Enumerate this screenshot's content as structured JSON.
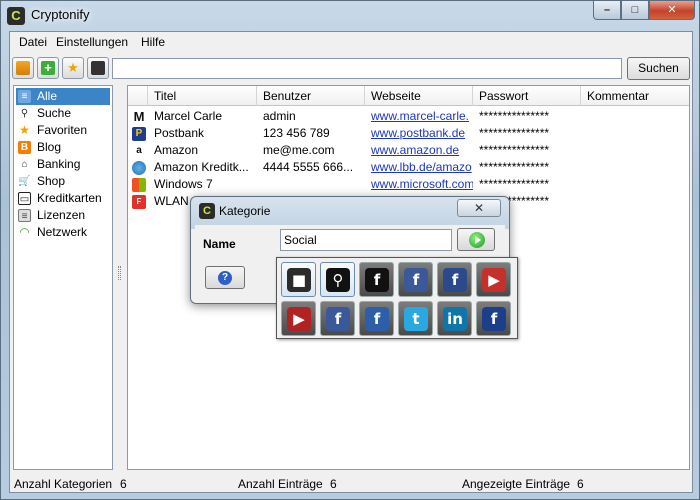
{
  "window": {
    "title": "Cryptonify",
    "minimize": "–",
    "maximize": "□",
    "close": "✕"
  },
  "menu": {
    "items": [
      "Datei",
      "Einstellungen",
      "Hilfe"
    ]
  },
  "toolbar": {
    "search_value": "",
    "search_button": "Suchen",
    "buttons": [
      "open-safe-icon",
      "add-entry-icon",
      "favorite-entry-icon",
      "save-icon"
    ]
  },
  "sidebar": {
    "items": [
      {
        "label": "Alle",
        "icon": "all-icon",
        "selected": true
      },
      {
        "label": "Suche",
        "icon": "magnifier-icon"
      },
      {
        "label": "Favoriten",
        "icon": "star-icon"
      },
      {
        "label": "Blog",
        "icon": "blogger-icon"
      },
      {
        "label": "Banking",
        "icon": "bank-icon"
      },
      {
        "label": "Shop",
        "icon": "cart-icon"
      },
      {
        "label": "Kreditkarten",
        "icon": "credit-card-icon"
      },
      {
        "label": "Lizenzen",
        "icon": "license-icon"
      },
      {
        "label": "Netzwerk",
        "icon": "wifi-icon"
      }
    ]
  },
  "table": {
    "columns": [
      "Titel",
      "Benutzer",
      "Webseite",
      "Passwort",
      "Kommentar"
    ],
    "rows": [
      {
        "icon": "marcel-m-icon",
        "titel": "Marcel Carle",
        "benutzer": "admin",
        "webseite": "www.marcel-carle.",
        "passwort": "***************",
        "kommentar": ""
      },
      {
        "icon": "postbank-icon",
        "titel": "Postbank",
        "benutzer": "123 456 789",
        "webseite": "www.postbank.de",
        "passwort": "***************",
        "kommentar": ""
      },
      {
        "icon": "amazon-icon",
        "titel": "Amazon",
        "benutzer": "me@me.com",
        "webseite": "www.amazon.de",
        "passwort": "***************",
        "kommentar": ""
      },
      {
        "icon": "globe-icon",
        "titel": "Amazon Kreditk...",
        "benutzer": "4444 5555 666...",
        "webseite": "www.lbb.de/amazo",
        "passwort": "***************",
        "kommentar": ""
      },
      {
        "icon": "windows-icon",
        "titel": "Windows 7",
        "benutzer": "",
        "webseite": "www.microsoft.com",
        "passwort": "***************",
        "kommentar": ""
      },
      {
        "icon": "fritzbox-icon",
        "titel": "WLAN",
        "benutzer": "",
        "webseite": "",
        "passwort": "***************",
        "kommentar": ""
      }
    ]
  },
  "status": {
    "kategorien_label": "Anzahl Kategorien",
    "kategorien_value": "6",
    "eintraege_label": "Anzahl Einträge",
    "eintraege_value": "6",
    "angezeigt_label": "Angezeigte Einträge",
    "angezeigt_value": "6"
  },
  "dialog": {
    "title": "Kategorie",
    "close": "✕",
    "name_label": "Name",
    "name_value": "Social",
    "help": "?"
  },
  "picker": {
    "icons": [
      {
        "name": "briefcase-icon",
        "glyph": "■",
        "color": "#2b2b2b",
        "selected": true
      },
      {
        "name": "magnifier-icon",
        "glyph": "⚲",
        "color": "#111111",
        "selected": true
      },
      {
        "name": "facebook-black-icon",
        "glyph": "f",
        "color": "#111111"
      },
      {
        "name": "facebook-grunge-icon",
        "glyph": "f",
        "color": "#3b5998"
      },
      {
        "name": "facebook-splash-icon",
        "glyph": "f",
        "color": "#2a4a8c"
      },
      {
        "name": "youtube-icon",
        "glyph": "▶",
        "color": "#c4302b"
      },
      {
        "name": "youtube-stamp-icon",
        "glyph": "▶",
        "color": "#b22222"
      },
      {
        "name": "facebook-white-icon",
        "glyph": "f",
        "color": "#3b5998"
      },
      {
        "name": "facebook-icon",
        "glyph": "f",
        "color": "#2d5ea8"
      },
      {
        "name": "twitter-icon",
        "glyph": "t",
        "color": "#2aa9e0"
      },
      {
        "name": "linkedin-icon",
        "glyph": "in",
        "color": "#0e76a8"
      },
      {
        "name": "facebook-dark-icon",
        "glyph": "f",
        "color": "#1d3f8a"
      }
    ]
  }
}
